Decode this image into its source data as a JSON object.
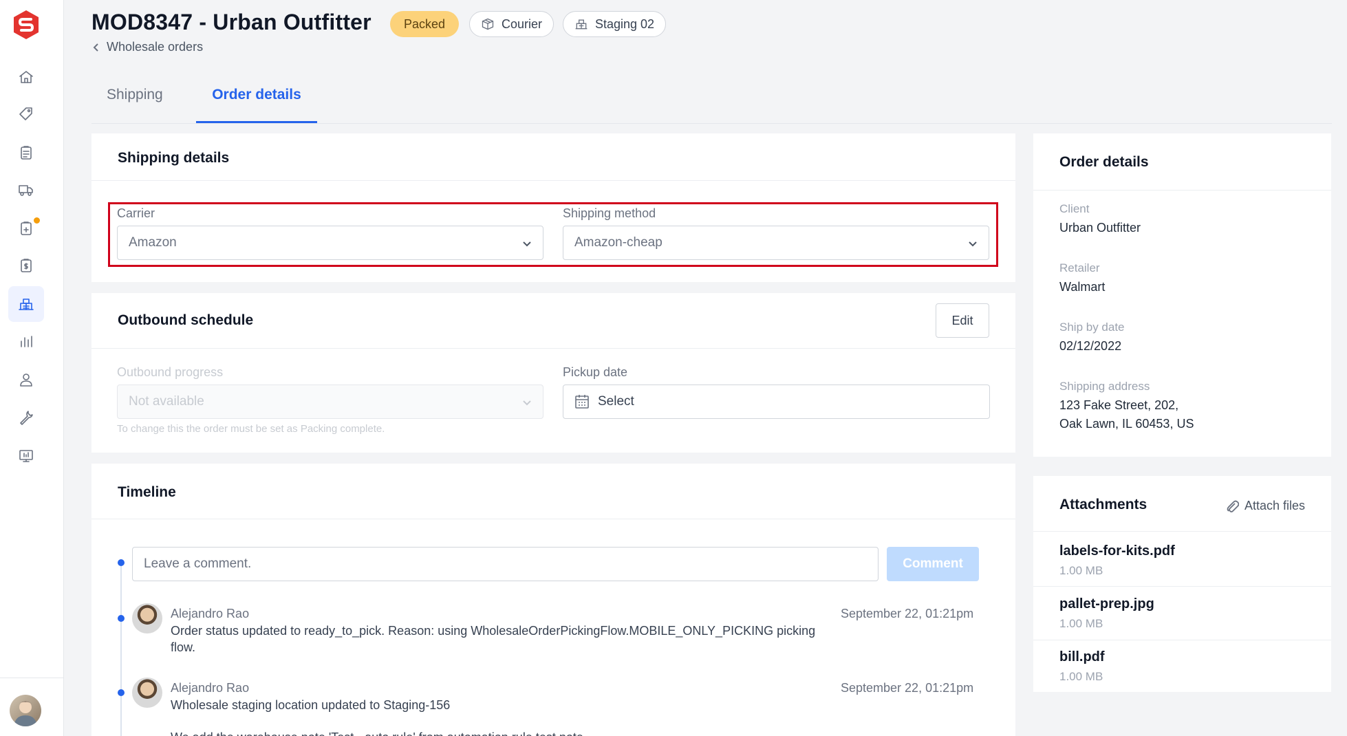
{
  "header": {
    "title": "MOD8347 - Urban Outfitter",
    "status_badge": "Packed",
    "courier_badge": "Courier",
    "staging_badge": "Staging 02",
    "breadcrumb": "Wholesale orders"
  },
  "tabs": [
    {
      "label": "Shipping",
      "active": false
    },
    {
      "label": "Order details",
      "active": true
    }
  ],
  "shipping_details": {
    "title": "Shipping details",
    "carrier_label": "Carrier",
    "carrier_value": "Amazon",
    "method_label": "Shipping method",
    "method_value": "Amazon-cheap"
  },
  "outbound_schedule": {
    "title": "Outbound schedule",
    "edit_label": "Edit",
    "progress_label": "Outbound progress",
    "progress_value": "Not available",
    "progress_hint": "To change this the order must be set as Packing complete.",
    "pickup_label": "Pickup date",
    "pickup_placeholder": "Select"
  },
  "timeline": {
    "title": "Timeline",
    "comment_placeholder": "Leave a comment.",
    "comment_button": "Comment",
    "entries": [
      {
        "author": "Alejandro Rao",
        "text": "Order status updated to ready_to_pick. Reason: using WholesaleOrderPickingFlow.MOBILE_ONLY_PICKING picking flow.",
        "time": "September 22, 01:21pm"
      },
      {
        "author": "Alejandro Rao",
        "text": "Wholesale staging location updated to Staging-156",
        "time": "September 22, 01:21pm"
      }
    ],
    "partial_entry": "We add the warehouse note 'Test - auto rule' from automation rule test note"
  },
  "order_details": {
    "title": "Order details",
    "client_label": "Client",
    "client_value": "Urban Outfitter",
    "retailer_label": "Retailer",
    "retailer_value": "Walmart",
    "ship_by_label": "Ship by date",
    "ship_by_value": "02/12/2022",
    "address_label": "Shipping address",
    "address_line1": "123 Fake Street, 202,",
    "address_line2": "Oak Lawn, IL 60453, US"
  },
  "attachments": {
    "title": "Attachments",
    "attach_label": "Attach files",
    "files": [
      {
        "name": "labels-for-kits.pdf",
        "size": "1.00 MB"
      },
      {
        "name": "pallet-prep.jpg",
        "size": "1.00 MB"
      },
      {
        "name": "bill.pdf",
        "size": "1.00 MB"
      }
    ]
  },
  "colors": {
    "accent": "#2563eb",
    "badge_packed": "#fcd27a",
    "highlight": "#d0021b",
    "brand": "#e3342f"
  }
}
